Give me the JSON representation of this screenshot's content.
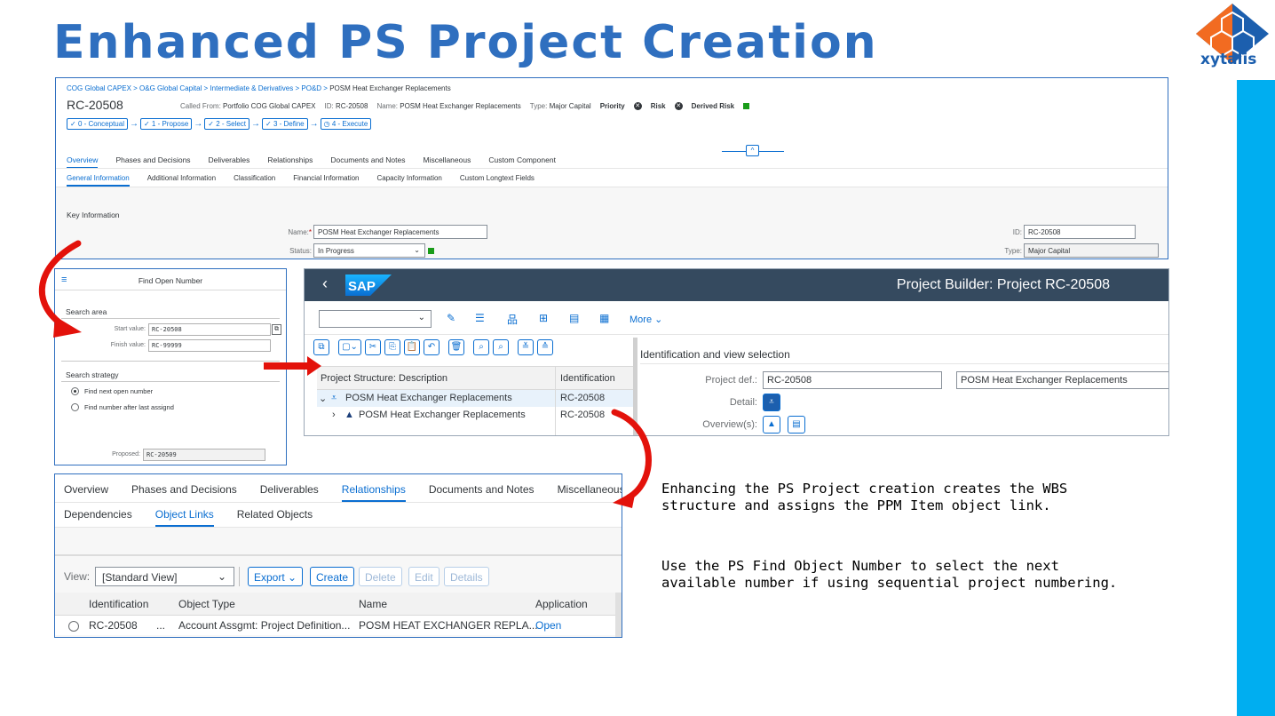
{
  "slide": {
    "title": "Enhanced PS Project Creation",
    "logo_text": "xytalis",
    "callout_1": "Enhancing the PS Project creation creates the WBS\nstructure and assigns the PPM Item object link.",
    "callout_2": "Use the PS Find Object Number to select the next\navailable number if using sequential project numbering."
  },
  "colors": {
    "title": "#2f6fbf",
    "accent": "#0a6ed1",
    "shell": "#354a5f",
    "sidebar": "#00aef0",
    "arrow": "#e3120b"
  },
  "overview_panel": {
    "breadcrumb": [
      "COG Global CAPEX",
      "O&G Global Capital",
      "Intermediate & Derivatives",
      "PO&D"
    ],
    "breadcrumb_sep": " > ",
    "breadcrumb_current": "POSM Heat Exchanger Replacements",
    "object_id": "RC-20508",
    "called_from_label": "Called From:",
    "called_from_value": "Portfolio COG Global CAPEX",
    "id_label": "ID:",
    "id_value": "RC-20508",
    "name_label": "Name:",
    "name_value": "POSM Heat Exchanger Replacements",
    "type_label": "Type:",
    "type_value": "Major Capital",
    "priority_label": "Priority",
    "risk_label": "Risk",
    "derived_risk_label": "Derived Risk",
    "phases": [
      "0 - Conceptual",
      "1 - Propose",
      "2 - Select",
      "3 - Define",
      "4 - Execute"
    ],
    "tabs": [
      "Overview",
      "Phases and Decisions",
      "Deliverables",
      "Relationships",
      "Documents and Notes",
      "Miscellaneous",
      "Custom Component"
    ],
    "subtabs": [
      "General Information",
      "Additional Information",
      "Classification",
      "Financial Information",
      "Capacity Information",
      "Custom Longtext Fields"
    ],
    "section_title": "Key Information",
    "form": {
      "name_label": "Name:",
      "name_value": "POSM Heat Exchanger Replacements",
      "status_label": "Status:",
      "status_value": "In Progress",
      "id_label": "ID:",
      "id_value": "RC-20508",
      "type_label": "Type:",
      "type_value": "Major Capital"
    }
  },
  "find_number_dialog": {
    "title": "Find Open Number",
    "search_area_label": "Search area",
    "start_label": "Start value:",
    "start_value": "RC-20508",
    "finish_label": "Finish value:",
    "finish_value": "RC-99999",
    "strategy_label": "Search strategy",
    "option_1": "Find next open number",
    "option_2": "Find number after last assignd",
    "proposed_label": "Proposed:",
    "proposed_value": "RC-20509"
  },
  "project_builder": {
    "logo": "SAP",
    "title": "Project Builder: Project RC-20508",
    "more_label": "More",
    "tree_col_1": "Project Structure: Description",
    "tree_col_2": "Identification",
    "rows": [
      {
        "desc": "POSM Heat Exchanger Replacements",
        "id": "RC-20508"
      },
      {
        "desc": "POSM Heat Exchanger Replacements",
        "id": "RC-20508"
      }
    ],
    "detail_title": "Identification and view selection",
    "project_def_label": "Project def.:",
    "project_def_value": "RC-20508",
    "project_def_desc": "POSM Heat Exchanger Replacements",
    "detail_label": "Detail:",
    "overviews_label": "Overview(s):"
  },
  "relationships_panel": {
    "tabs": [
      "Overview",
      "Phases and Decisions",
      "Deliverables",
      "Relationships",
      "Documents and Notes",
      "Miscellaneous"
    ],
    "subtabs": [
      "Dependencies",
      "Object Links",
      "Related Objects"
    ],
    "view_label": "View:",
    "view_value": "[Standard View]",
    "export_label": "Export",
    "create_label": "Create",
    "delete_label": "Delete",
    "edit_label": "Edit",
    "details_label": "Details",
    "columns": [
      "Identification",
      "Object Type",
      "Name",
      "Application"
    ],
    "row": {
      "identification": "RC-20508",
      "ellipsis": "...",
      "object_type": "Account Assgmt: Project Definition...",
      "name": "POSM HEAT EXCHANGER REPLA...",
      "application": "Open"
    }
  }
}
